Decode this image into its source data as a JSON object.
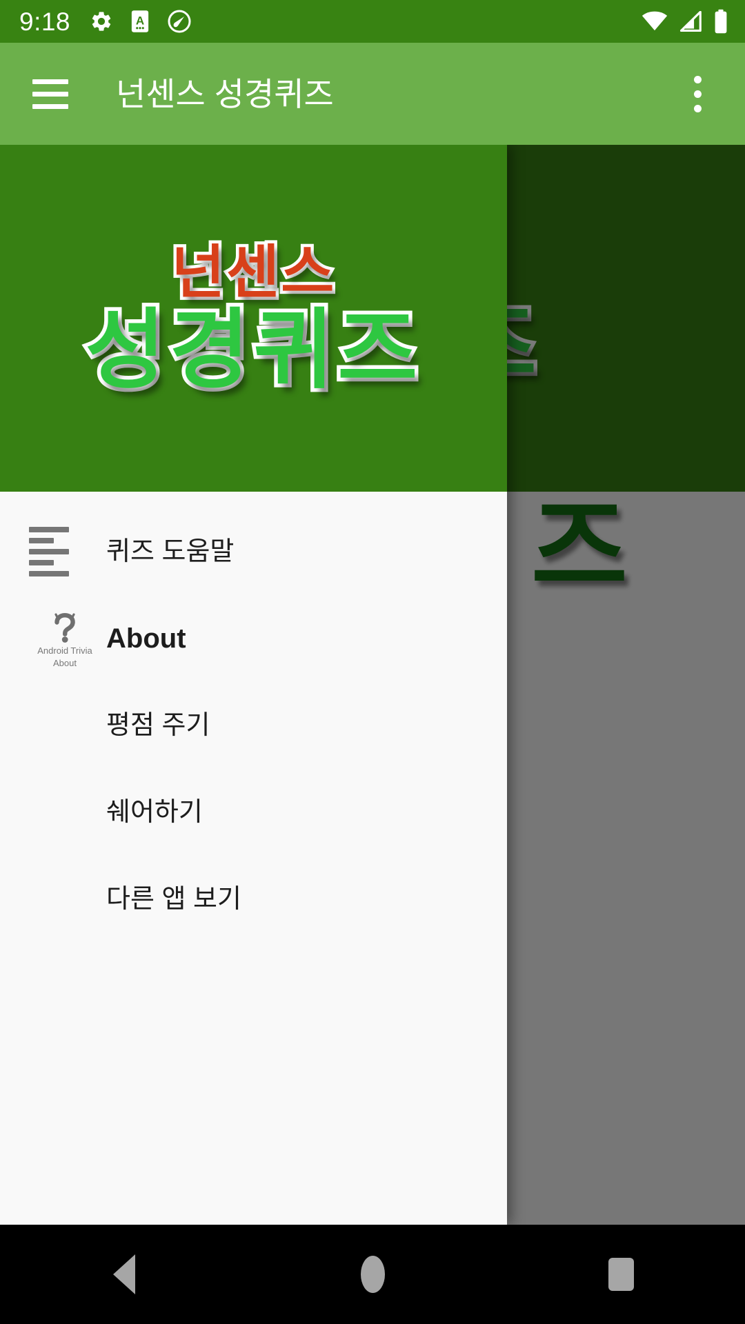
{
  "status_bar": {
    "time": "9:18",
    "left_icons": [
      "gear-icon",
      "a-badge-icon",
      "slash-circle-icon"
    ],
    "right_icons": [
      "wifi-icon",
      "cell-signal-icon",
      "battery-icon"
    ],
    "background_color": "#388312",
    "foreground_color": "#ffffff"
  },
  "app_bar": {
    "title": "넌센스 성경퀴즈",
    "menu_icon": "hamburger-menu-icon",
    "overflow_icon": "overflow-menu-icon",
    "background_color": "#6cb04b",
    "title_color": "#ffffff"
  },
  "drawer": {
    "header": {
      "logo_line1": "넌센스",
      "logo_line2": "성경퀴즈",
      "line1_color": "#d8401a",
      "line2_color": "#2ec741",
      "outline_color": "#ffffff",
      "background_color": "#378013"
    },
    "background_color": "#f9f9f9",
    "items": [
      {
        "label": "퀴즈 도움말",
        "icon": "format-align-left-icon",
        "bold": false,
        "caption": null
      },
      {
        "label": "About",
        "icon": "android-question-mark-icon",
        "bold": true,
        "caption_line1": "Android Trivia",
        "caption_line2": "About"
      },
      {
        "label": "평점 주기",
        "icon": null,
        "bold": false,
        "caption": null
      },
      {
        "label": "쉐어하기",
        "icon": null,
        "bold": false,
        "caption": null
      },
      {
        "label": "다른 앱 보기",
        "icon": null,
        "bold": false,
        "caption": null
      }
    ]
  },
  "background_content": {
    "logo_line1": "넌센스",
    "logo_line2": "성경퀴즈",
    "partial_glyph": "즈",
    "scrim_color": "rgba(0,0,0,0.52)"
  },
  "navigation_bar": {
    "background_color": "#000000",
    "buttons": [
      {
        "name": "back-button",
        "icon": "triangle-back-icon"
      },
      {
        "name": "home-button",
        "icon": "circle-home-icon"
      },
      {
        "name": "recents-button",
        "icon": "square-recents-icon"
      }
    ]
  }
}
